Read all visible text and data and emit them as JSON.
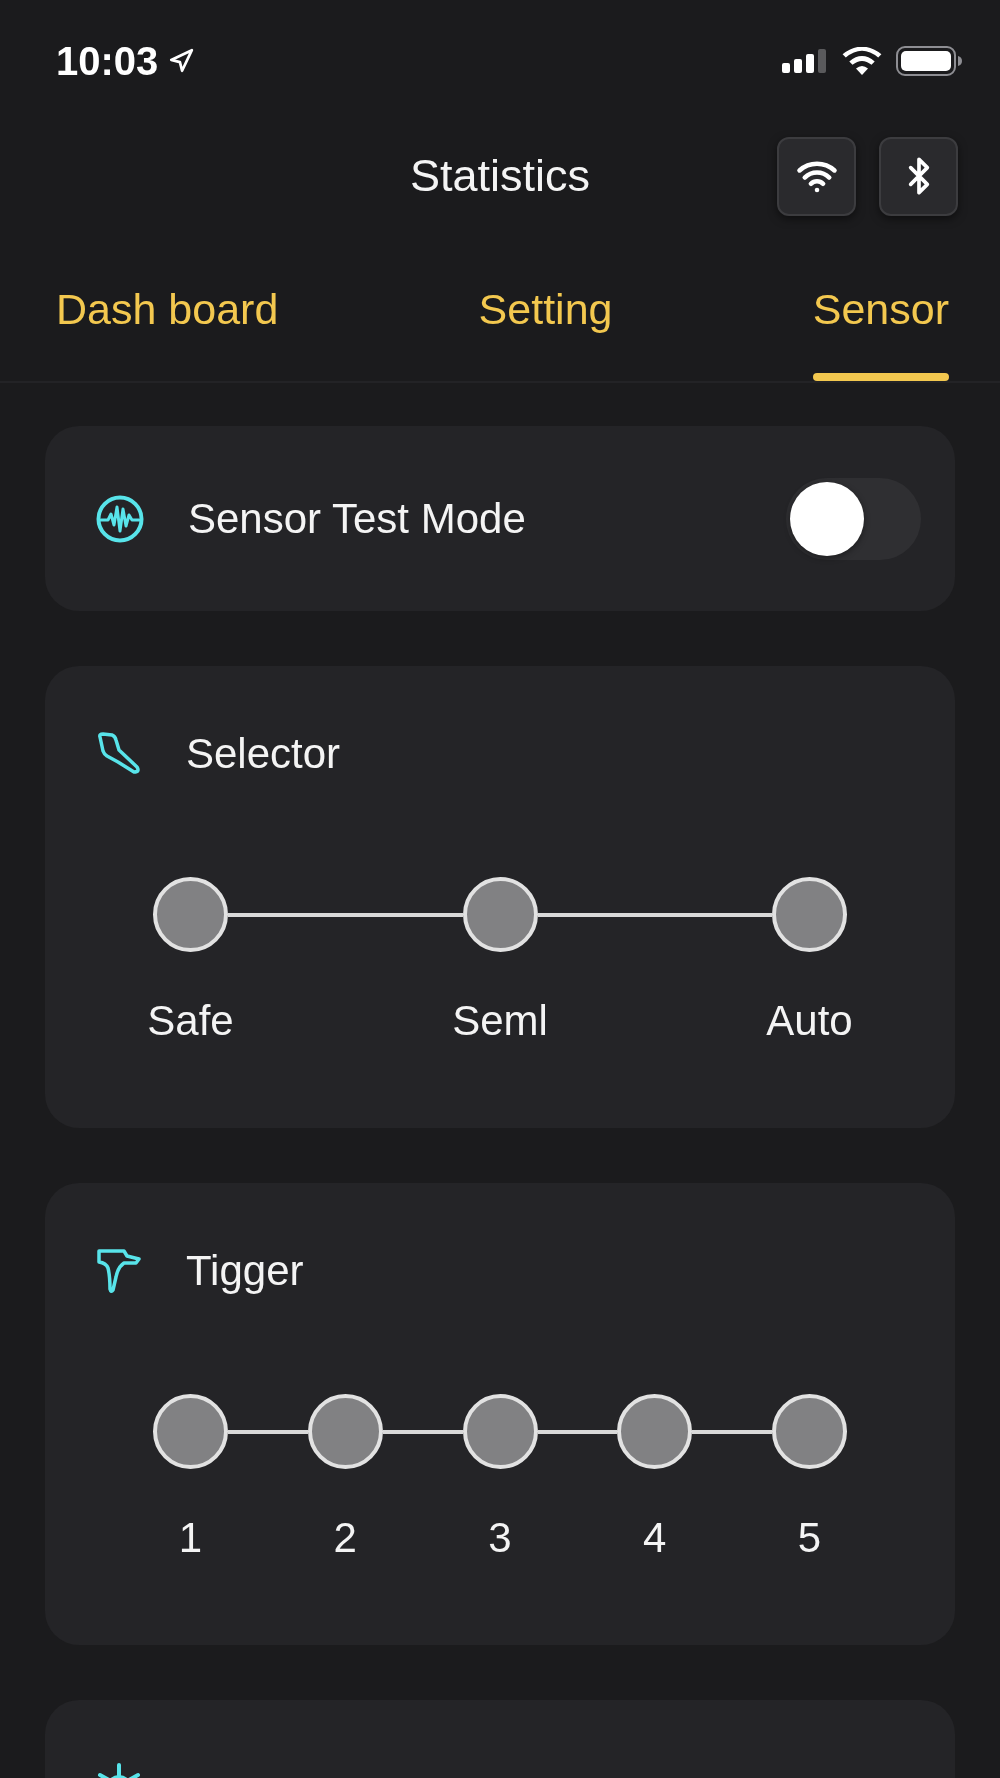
{
  "status_bar": {
    "time": "10:03"
  },
  "header": {
    "title": "Statistics"
  },
  "tabs": [
    {
      "label": "Dash board",
      "selected": false
    },
    {
      "label": "Setting",
      "selected": false
    },
    {
      "label": "Sensor",
      "selected": true
    }
  ],
  "cards": [
    {
      "kind": "toggle",
      "title": "Sensor Test Mode",
      "on": false
    },
    {
      "kind": "steps",
      "title": "Selector",
      "steps": [
        {
          "label": "Safe",
          "selected": false
        },
        {
          "label": "Seml",
          "selected": false
        },
        {
          "label": "Auto",
          "selected": false
        }
      ]
    },
    {
      "kind": "steps",
      "title": "Tigger",
      "steps": [
        {
          "label": "1",
          "selected": false
        },
        {
          "label": "2",
          "selected": false
        },
        {
          "label": "3",
          "selected": false
        },
        {
          "label": "4",
          "selected": false
        },
        {
          "label": "5",
          "selected": false
        }
      ]
    },
    {
      "kind": "partial"
    }
  ]
}
